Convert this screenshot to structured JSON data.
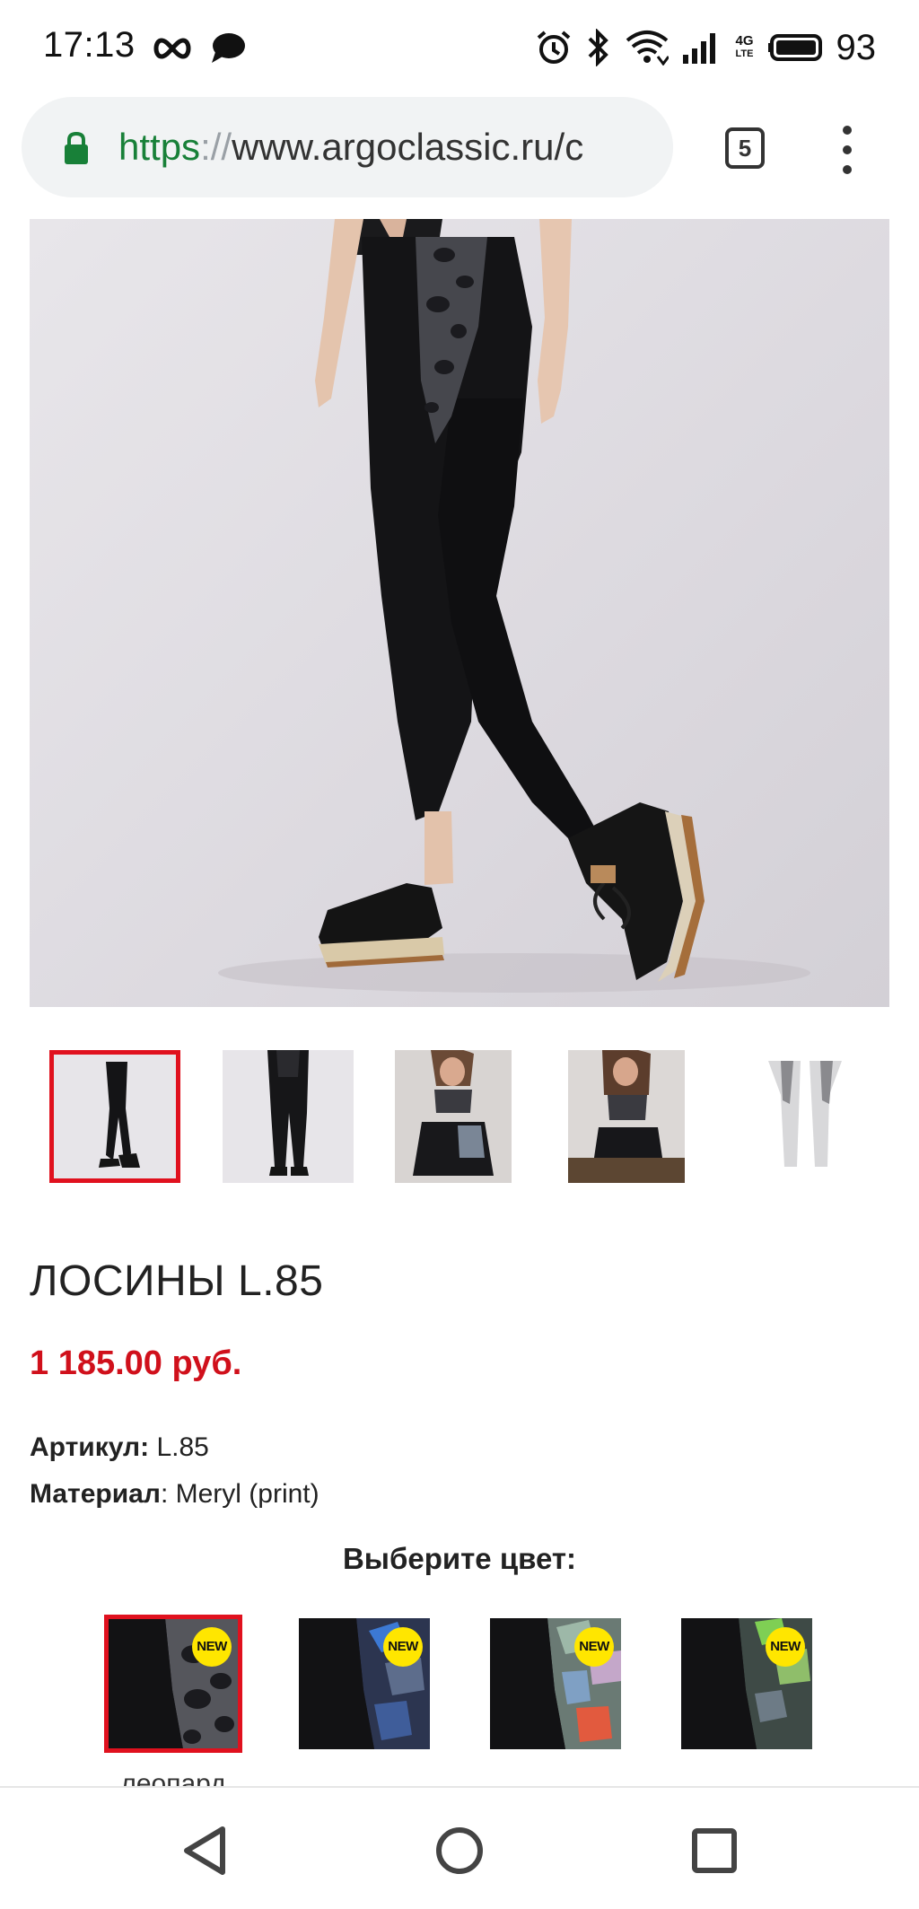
{
  "status_bar": {
    "time": "17:13",
    "battery": "93",
    "network_top": "4G",
    "network_bottom": "LTE",
    "icons": [
      "infinity-icon",
      "chat-bubble-icon",
      "alarm-icon",
      "bluetooth-icon",
      "wifi-icon",
      "signal-icon",
      "battery-icon"
    ]
  },
  "browser": {
    "url_scheme": "https",
    "url_separator": "://",
    "url_rest": "www.argoclassic.ru/c",
    "tab_count": "5",
    "icons": [
      "lock-icon",
      "menu-icon"
    ]
  },
  "product": {
    "title": "ЛОСИНЫ L.85",
    "price": "1 185.00 руб.",
    "article_label": "Артикул:",
    "article_value": "L.85",
    "material_label": "Материал",
    "material_value": ": Meryl (print)",
    "thumbnails": [
      "thumb-front",
      "thumb-back",
      "thumb-model-sitting",
      "thumb-model-pose",
      "thumb-flat-grey"
    ]
  },
  "color_picker": {
    "heading": "Выберите цвет:",
    "badge": "NEW",
    "swatches": [
      "леопард"
    ],
    "accent": "#e0111e",
    "badge_color": "#ffe600"
  },
  "colors": {
    "price": "#d0101b",
    "selected_border": "#e0111e",
    "url_green": "#188038"
  },
  "nav": {
    "icons": [
      "back-icon",
      "home-icon",
      "recents-icon"
    ]
  }
}
